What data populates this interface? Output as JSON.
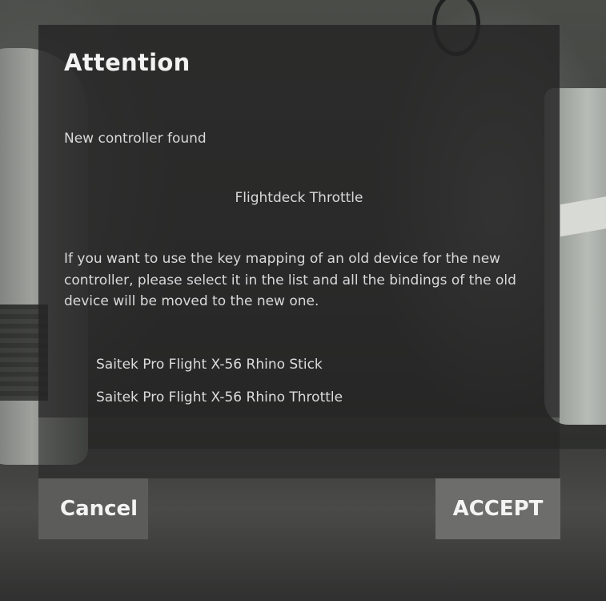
{
  "dialog": {
    "title": "Attention",
    "subtitle": "New controller found",
    "new_device": "Flightdeck Throttle",
    "message": "If you want to use the key mapping of an old device for the new controller, please select it in the list and all the bindings of the old device will be moved to the new one.",
    "old_devices": [
      "Saitek Pro Flight X-56 Rhino Stick",
      "Saitek Pro Flight X-56 Rhino Throttle"
    ]
  },
  "buttons": {
    "cancel_label": "Cancel",
    "accept_label": "ACCEPT"
  }
}
